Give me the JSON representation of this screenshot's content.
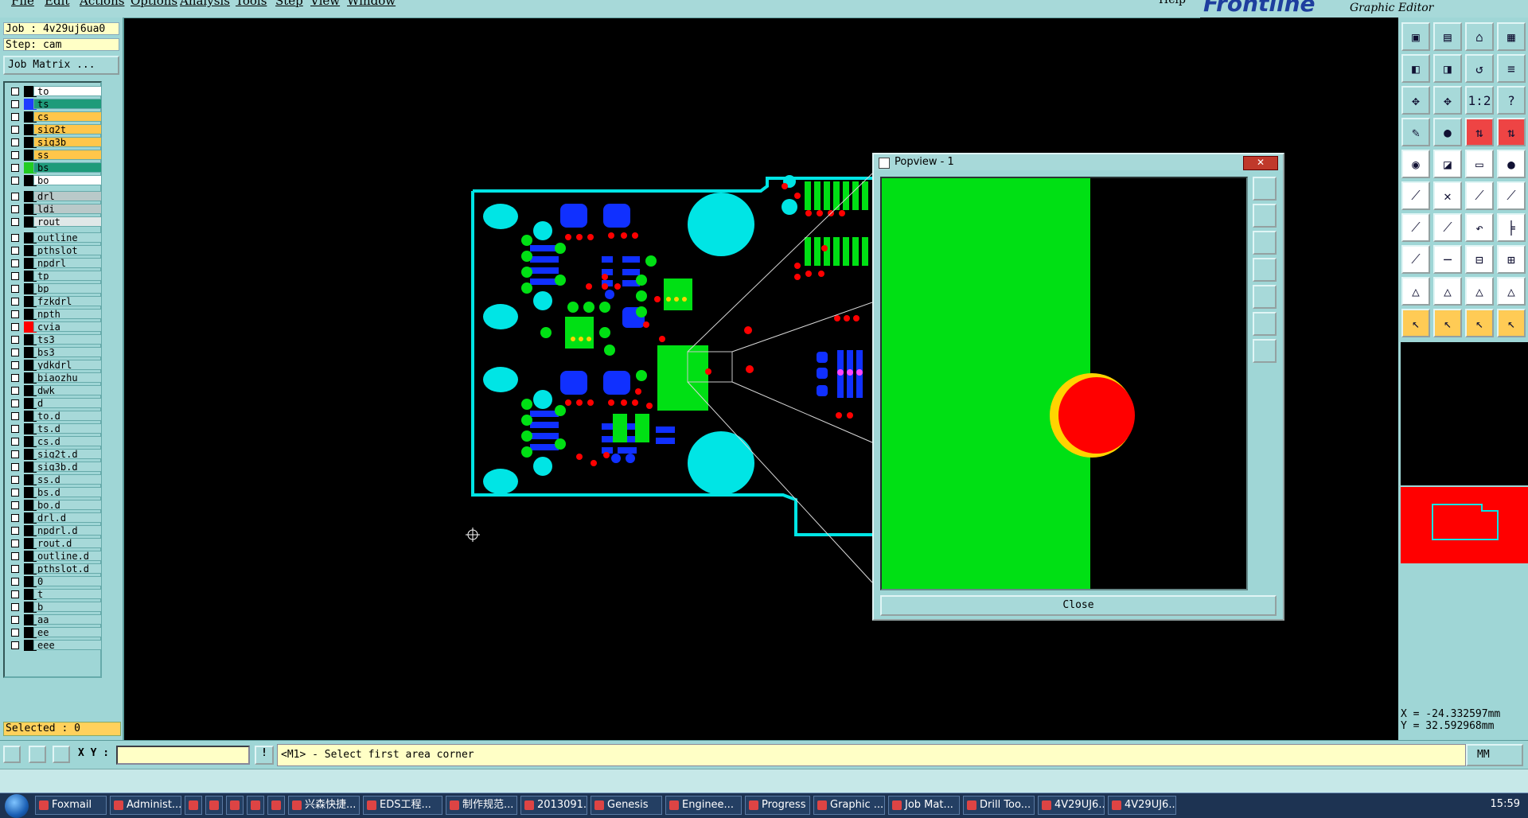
{
  "menu": {
    "items": [
      "File",
      "Edit",
      "Actions",
      "Options",
      "Analysis",
      "Tools",
      "Step",
      "View",
      "Window"
    ],
    "help": "Help"
  },
  "brand": {
    "logo": "Frontline",
    "subtitle": "Graphic Editor"
  },
  "job": {
    "label": "Job : 4v29uj6ua0",
    "step": "Step: cam",
    "matrix_button": "Job Matrix ..."
  },
  "layers": [
    {
      "name": "to",
      "color": "#ffffff",
      "swatch": "#000000"
    },
    {
      "name": "ts",
      "color": "#1e9b7a",
      "swatch": "#1f3cff"
    },
    {
      "name": "cs",
      "color": "#ffc64a",
      "swatch": "#000000"
    },
    {
      "name": "sig2t",
      "color": "#ffc64a",
      "swatch": "#000000"
    },
    {
      "name": "sig3b",
      "color": "#ffc64a",
      "swatch": "#000000"
    },
    {
      "name": "ss",
      "color": "#ffc64a",
      "swatch": "#000000"
    },
    {
      "name": "bs",
      "color": "#1e9b7a",
      "swatch": "#22cc22"
    },
    {
      "name": "bo",
      "color": "#ffffff",
      "swatch": "#000000"
    },
    {
      "name": "drl",
      "color": "#b9c9c9",
      "swatch": "#000000"
    },
    {
      "name": "ldi",
      "color": "#b9c9c9",
      "swatch": "#000000"
    },
    {
      "name": "rout",
      "color": "#e0e8e8",
      "swatch": "#000000"
    },
    {
      "name": "outline",
      "color": "#a7d9d9",
      "swatch": "#000000"
    },
    {
      "name": "pthslot",
      "color": "#a7d9d9",
      "swatch": "#000000"
    },
    {
      "name": "npdrl",
      "color": "#a7d9d9",
      "swatch": "#000000"
    },
    {
      "name": "tp",
      "color": "#a7d9d9",
      "swatch": "#000000"
    },
    {
      "name": "bp",
      "color": "#a7d9d9",
      "swatch": "#000000"
    },
    {
      "name": "fzkdrl",
      "color": "#a7d9d9",
      "swatch": "#000000"
    },
    {
      "name": "npth",
      "color": "#a7d9d9",
      "swatch": "#000000"
    },
    {
      "name": "cvia",
      "color": "#a7d9d9",
      "swatch": "#ff0000"
    },
    {
      "name": "ts3",
      "color": "#a7d9d9",
      "swatch": "#000000"
    },
    {
      "name": "bs3",
      "color": "#a7d9d9",
      "swatch": "#000000"
    },
    {
      "name": "ydkdrl",
      "color": "#a7d9d9",
      "swatch": "#000000"
    },
    {
      "name": "biaozhu",
      "color": "#a7d9d9",
      "swatch": "#000000"
    },
    {
      "name": "dwk",
      "color": "#a7d9d9",
      "swatch": "#000000"
    },
    {
      "name": "d",
      "color": "#a7d9d9",
      "swatch": "#000000"
    },
    {
      "name": "to.d",
      "color": "#a7d9d9",
      "swatch": "#000000"
    },
    {
      "name": "ts.d",
      "color": "#a7d9d9",
      "swatch": "#000000"
    },
    {
      "name": "cs.d",
      "color": "#a7d9d9",
      "swatch": "#000000"
    },
    {
      "name": "sig2t.d",
      "color": "#a7d9d9",
      "swatch": "#000000"
    },
    {
      "name": "sig3b.d",
      "color": "#a7d9d9",
      "swatch": "#000000"
    },
    {
      "name": "ss.d",
      "color": "#a7d9d9",
      "swatch": "#000000"
    },
    {
      "name": "bs.d",
      "color": "#a7d9d9",
      "swatch": "#000000"
    },
    {
      "name": "bo.d",
      "color": "#a7d9d9",
      "swatch": "#000000"
    },
    {
      "name": "drl.d",
      "color": "#a7d9d9",
      "swatch": "#000000"
    },
    {
      "name": "npdrl.d",
      "color": "#a7d9d9",
      "swatch": "#000000"
    },
    {
      "name": "rout.d",
      "color": "#a7d9d9",
      "swatch": "#000000"
    },
    {
      "name": "outline.d",
      "color": "#a7d9d9",
      "swatch": "#000000"
    },
    {
      "name": "pthslot.d",
      "color": "#a7d9d9",
      "swatch": "#000000"
    },
    {
      "name": "0",
      "color": "#a7d9d9",
      "swatch": "#000000"
    },
    {
      "name": "t",
      "color": "#a7d9d9",
      "swatch": "#000000"
    },
    {
      "name": "b",
      "color": "#a7d9d9",
      "swatch": "#000000"
    },
    {
      "name": "aa",
      "color": "#a7d9d9",
      "swatch": "#000000"
    },
    {
      "name": "ee",
      "color": "#a7d9d9",
      "swatch": "#000000"
    },
    {
      "name": "eee",
      "color": "#a7d9d9",
      "swatch": "#000000"
    }
  ],
  "selected": "Selected : 0",
  "bottom": {
    "xy_label": "X Y :",
    "xy_value": "",
    "prompt": "<M1> - Select first area corner",
    "units": "MM",
    "excl": "!"
  },
  "coords": {
    "x": "X = -24.332597mm",
    "y": "Y = 32.592968mm"
  },
  "popview": {
    "title": "Popview - 1",
    "close_label": "Close"
  },
  "taskbar": {
    "items": [
      "Foxmail",
      "Administ...",
      "",
      "",
      "",
      "",
      "",
      "兴森快捷...",
      "EDS工程...",
      "制作规范...",
      "2013091...",
      "Genesis",
      "Enginee...",
      "Progress",
      "Graphic ...",
      "Job Mat...",
      "Drill Too...",
      "4V29UJ6...",
      "4V29UJ6..."
    ],
    "clock": "15:59"
  },
  "colors": {
    "panel": "#9fd6d6",
    "cyan_layer": "#00e5e5",
    "green_layer": "#00e014",
    "blue_layer": "#1030ff",
    "red_layer": "#ff0000",
    "yellow_ring": "#ffd400"
  },
  "icons": [
    "open-job-icon",
    "save-icon",
    "home-icon",
    "window-icon",
    "zoom-icon",
    "pan-icon",
    "measure-icon",
    "help-icon",
    "select-icon",
    "move-icon",
    "rotate-icon",
    "arrow-icon"
  ]
}
